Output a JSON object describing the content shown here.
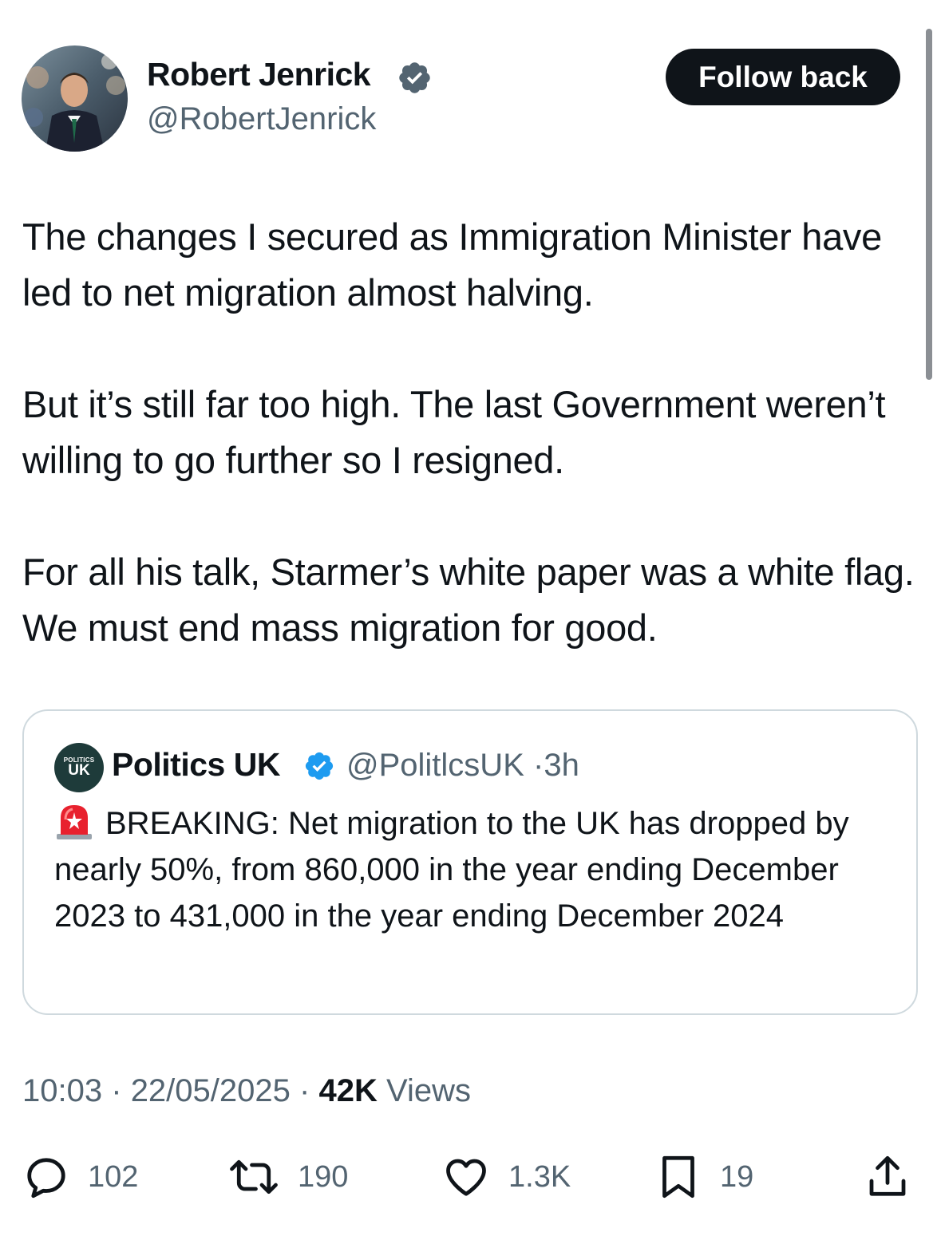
{
  "author": {
    "name": "Robert Jenrick",
    "handle": "@RobertJenrick",
    "verified": true,
    "avatar_icon": "profile-photo"
  },
  "follow_button_label": "Follow back",
  "tweet": {
    "paragraphs": [
      "The changes I secured as Immigration Minister have led to net migration almost halving.",
      "But it’s still far too high. The last Government weren’t willing to go further so I resigned.",
      "For all his talk, Starmer’s white paper was a white flag. We must end mass migration for good."
    ]
  },
  "quoted_tweet": {
    "avatar_text_small": "POLITICS",
    "avatar_text_big": "UK",
    "name": "Politics UK",
    "verified": true,
    "handle": "@PolitlcsUK",
    "separator": "·",
    "time_ago": "3h",
    "emoji": "rotating-light-icon",
    "text": "BREAKING: Net migration to the UK has dropped by nearly 50%, from 860,000 in the year ending December 2023 to 431,000 in the year ending December 2024"
  },
  "meta": {
    "time": "10:03",
    "separator": "·",
    "date": "22/05/2025",
    "views_count": "42K",
    "views_label": "Views"
  },
  "actions": {
    "replies": "102",
    "reposts": "190",
    "likes": "1.3K",
    "bookmarks": "19"
  },
  "colors": {
    "text_primary": "#0f1419",
    "text_secondary": "#536471",
    "verified_blue": "#1d9bf0",
    "border": "#cfd9de",
    "button_bg": "#0f1419"
  }
}
